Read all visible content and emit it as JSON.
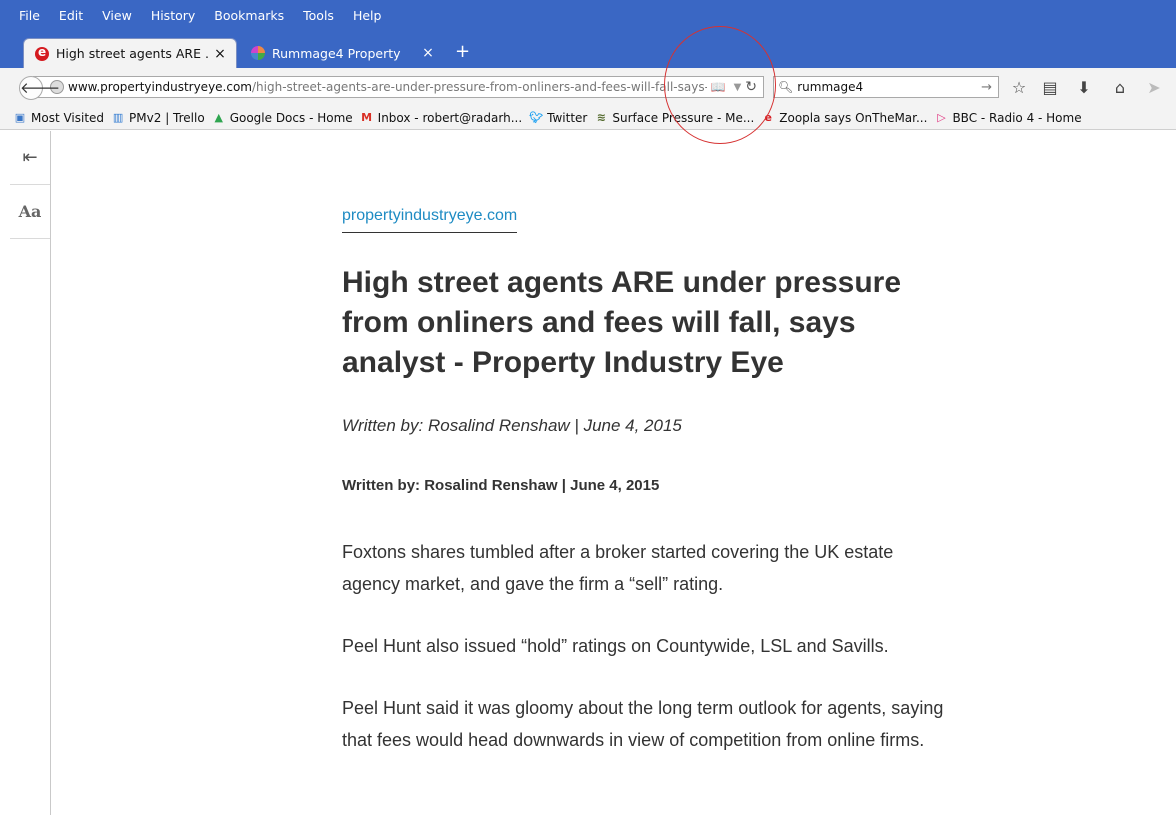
{
  "menubar": [
    "File",
    "Edit",
    "View",
    "History",
    "Bookmarks",
    "Tools",
    "Help"
  ],
  "tabs": [
    {
      "title": "High street agents ARE ...",
      "close": "×"
    },
    {
      "title": "Rummage4 Property",
      "close": "×"
    }
  ],
  "new_tab": "+",
  "nav": {
    "url_host": "www.propertyindustryeye.com",
    "url_path": "/high-street-agents-are-under-pressure-from-onliners-and-fees-will-fall-says-cr",
    "search_value": "rummage4"
  },
  "bookmarks": [
    {
      "label": "Most Visited",
      "icon": "folder-icon",
      "color": "#3a77c8"
    },
    {
      "label": "PMv2 | Trello",
      "icon": "trello-icon",
      "color": "#2f7ad1"
    },
    {
      "label": "Google Docs - Home",
      "icon": "google-drive-icon",
      "color": "#2fa550"
    },
    {
      "label": "Inbox - robert@radarh...",
      "icon": "gmail-icon",
      "color": "#d93025"
    },
    {
      "label": "Twitter",
      "icon": "twitter-icon",
      "color": "#1da1f2"
    },
    {
      "label": "Surface Pressure - Me...",
      "icon": "met-office-icon",
      "color": "#556b2f"
    },
    {
      "label": "Zoopla says OnTheMar...",
      "icon": "eye-logo-icon",
      "color": "#d51b20"
    },
    {
      "label": "BBC - Radio 4 - Home",
      "icon": "bbc-radio-icon",
      "color": "#e0337f"
    }
  ],
  "reader": {
    "sidebar_aa": "Aa",
    "domain": "propertyindustryeye.com",
    "title": "High street agents ARE under pressure from onliners and fees will fall, says analyst - Property Industry Eye",
    "byline_italic": "Written by: Rosalind Renshaw | June 4, 2015",
    "byline_bold": "Written by: Rosalind Renshaw | June 4, 2015",
    "paragraphs": [
      "Foxtons shares tumbled after a broker started covering the UK estate agency market, and gave the firm a “sell” rating.",
      "Peel Hunt also issued “hold” ratings on Countywide, LSL and Savills.",
      "Peel Hunt said it was gloomy about the long term outlook for agents, saying that fees would head downwards in view of competition from online firms."
    ]
  },
  "colors": {
    "chrome_blue": "#3a67c4",
    "link_blue": "#1e8bc3",
    "annotation_red": "#d63232"
  }
}
